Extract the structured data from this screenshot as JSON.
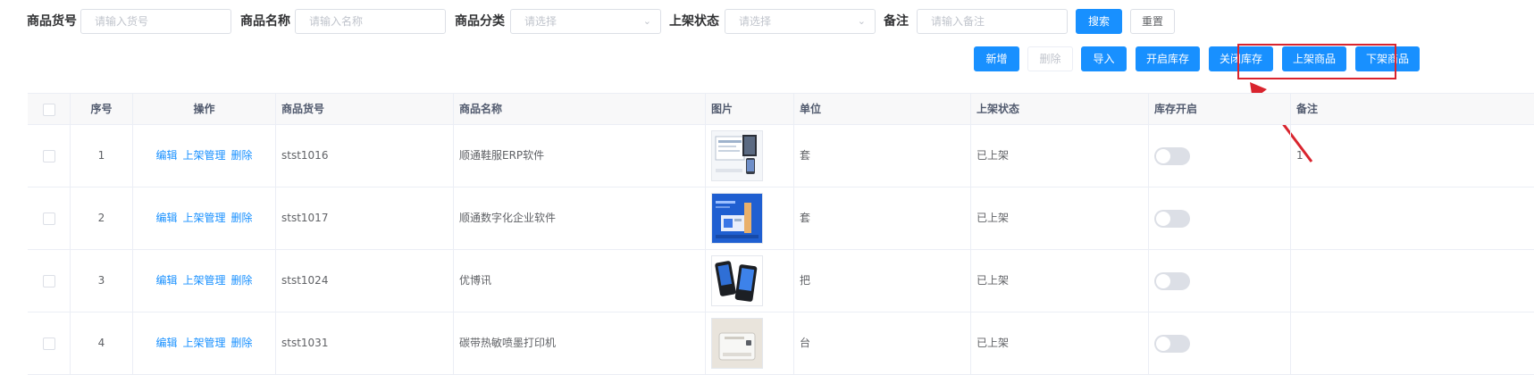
{
  "search": {
    "sku_label": "商品货号",
    "sku_placeholder": "请输入货号",
    "name_label": "商品名称",
    "name_placeholder": "请输入名称",
    "category_label": "商品分类",
    "category_placeholder": "请选择",
    "status_label": "上架状态",
    "status_placeholder": "请选择",
    "remark_label": "备注",
    "remark_placeholder": "请输入备注",
    "search_btn": "搜索",
    "reset_btn": "重置"
  },
  "toolbar": {
    "add": "新增",
    "delete": "删除",
    "import": "导入",
    "enable_stock": "开启库存",
    "disable_stock": "关闭库存",
    "list_product": "上架商品",
    "delist_product": "下架商品"
  },
  "table": {
    "headers": [
      "序号",
      "操作",
      "商品货号",
      "商品名称",
      "图片",
      "单位",
      "上架状态",
      "库存开启",
      "备注"
    ],
    "actions": {
      "edit": "编辑",
      "manage": "上架管理",
      "delete": "删除"
    },
    "rows": [
      {
        "index": "1",
        "sku": "stst1016",
        "name": "顺通鞋服ERP软件",
        "unit": "套",
        "status": "已上架",
        "stock_enabled": false,
        "remark": "1",
        "image_icon": "software-screenshot-icon"
      },
      {
        "index": "2",
        "sku": "stst1017",
        "name": "顺通数字化企业软件",
        "unit": "套",
        "status": "已上架",
        "stock_enabled": false,
        "remark": "",
        "image_icon": "enterprise-software-icon"
      },
      {
        "index": "3",
        "sku": "stst1024",
        "name": "优博讯",
        "unit": "把",
        "status": "已上架",
        "stock_enabled": false,
        "remark": "",
        "image_icon": "handheld-device-icon"
      },
      {
        "index": "4",
        "sku": "stst1031",
        "name": "碳带热敏喷墨打印机",
        "unit": "台",
        "status": "已上架",
        "stock_enabled": false,
        "remark": "",
        "image_icon": "printer-icon"
      }
    ]
  },
  "colors": {
    "primary": "#1890ff",
    "highlight": "#d9242e"
  }
}
